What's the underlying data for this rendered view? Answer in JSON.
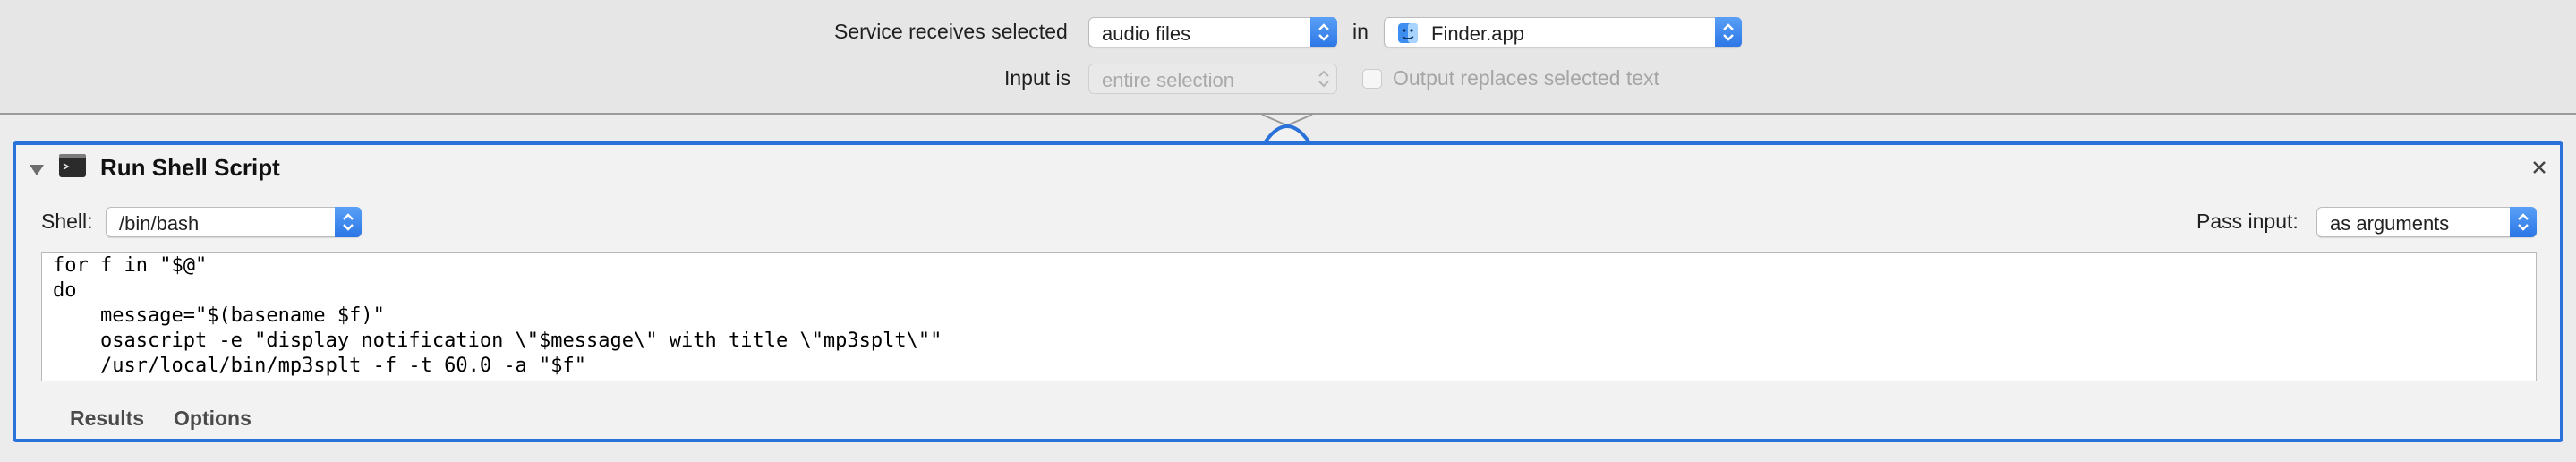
{
  "header": {
    "service_label": "Service receives selected",
    "service_value": "audio files",
    "in_label": "in",
    "app_value": "Finder.app",
    "input_label": "Input is",
    "input_value": "entire selection",
    "output_replaces_label": "Output replaces selected text"
  },
  "action": {
    "title": "Run Shell Script",
    "shell_label": "Shell:",
    "shell_value": "/bin/bash",
    "pass_input_label": "Pass input:",
    "pass_input_value": "as arguments",
    "script_lines": [
      "for f in \"$@\"",
      "do",
      "    message=\"$(basename $f)\"",
      "    osascript -e \"display notification \\\"$message\\\" with title \\\"mp3splt\\\"\"",
      "    /usr/local/bin/mp3splt -f -t 60.0 -a \"$f\""
    ],
    "tabs": [
      "Results",
      "Options"
    ]
  },
  "colors": {
    "accent": "#2a72d9",
    "stepper": "#3b86ee"
  }
}
